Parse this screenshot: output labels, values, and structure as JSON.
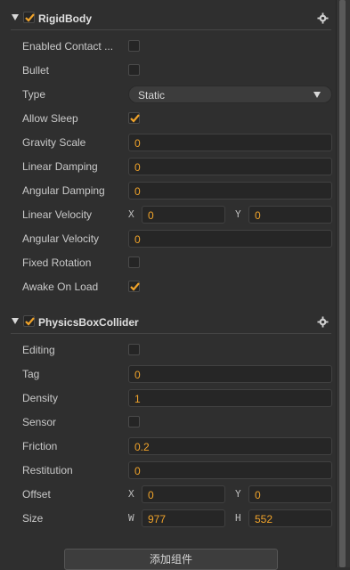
{
  "rigidbody": {
    "title": "RigidBody",
    "enabled": true,
    "icon": "gear-icon",
    "props": {
      "enabled_contact": {
        "label": "Enabled Contact ...",
        "checked": false
      },
      "bullet": {
        "label": "Bullet",
        "checked": false
      },
      "type": {
        "label": "Type",
        "value": "Static"
      },
      "allow_sleep": {
        "label": "Allow Sleep",
        "checked": true
      },
      "gravity_scale": {
        "label": "Gravity Scale",
        "value": "0"
      },
      "linear_damping": {
        "label": "Linear Damping",
        "value": "0"
      },
      "angular_damping": {
        "label": "Angular Damping",
        "value": "0"
      },
      "linear_velocity": {
        "label": "Linear Velocity",
        "x_label": "X",
        "x": "0",
        "y_label": "Y",
        "y": "0"
      },
      "angular_velocity": {
        "label": "Angular Velocity",
        "value": "0"
      },
      "fixed_rotation": {
        "label": "Fixed Rotation",
        "checked": false
      },
      "awake_on_load": {
        "label": "Awake On Load",
        "checked": true
      }
    }
  },
  "collider": {
    "title": "PhysicsBoxCollider",
    "enabled": true,
    "icon": "gear-icon",
    "props": {
      "editing": {
        "label": "Editing",
        "checked": false
      },
      "tag": {
        "label": "Tag",
        "value": "0"
      },
      "density": {
        "label": "Density",
        "value": "1"
      },
      "sensor": {
        "label": "Sensor",
        "checked": false
      },
      "friction": {
        "label": "Friction",
        "value": "0.2"
      },
      "restitution": {
        "label": "Restitution",
        "value": "0"
      },
      "offset": {
        "label": "Offset",
        "x_label": "X",
        "x": "0",
        "y_label": "Y",
        "y": "0"
      },
      "size": {
        "label": "Size",
        "w_label": "W",
        "w": "977",
        "h_label": "H",
        "h": "552"
      }
    }
  },
  "add_component_label": "添加组件",
  "colors": {
    "accent": "#f0a32a",
    "panel": "#2f2f2f",
    "field": "#262626"
  }
}
